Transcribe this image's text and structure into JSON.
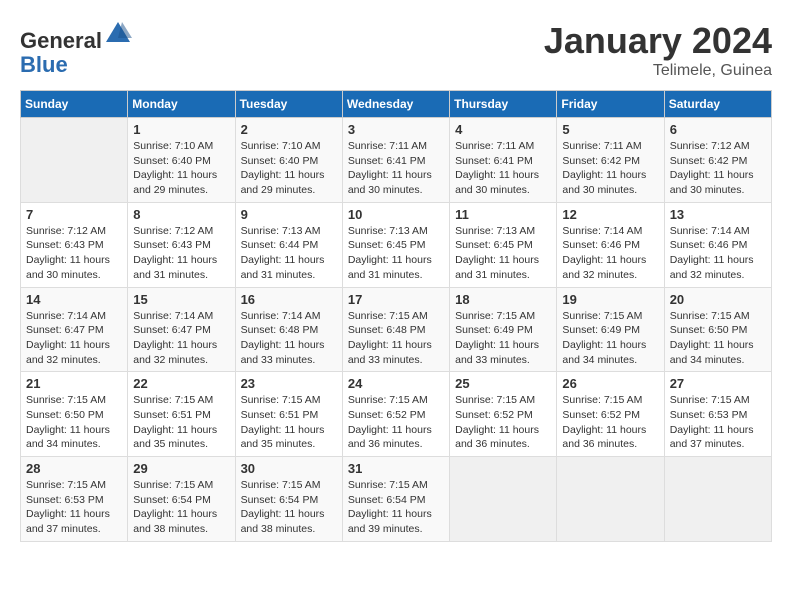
{
  "logo": {
    "general": "General",
    "blue": "Blue"
  },
  "header": {
    "title": "January 2024",
    "subtitle": "Telimele, Guinea"
  },
  "weekdays": [
    "Sunday",
    "Monday",
    "Tuesday",
    "Wednesday",
    "Thursday",
    "Friday",
    "Saturday"
  ],
  "weeks": [
    [
      {
        "day": "",
        "empty": true
      },
      {
        "day": "1",
        "sunrise": "7:10 AM",
        "sunset": "6:40 PM",
        "daylight": "11 hours and 29 minutes."
      },
      {
        "day": "2",
        "sunrise": "7:10 AM",
        "sunset": "6:40 PM",
        "daylight": "11 hours and 29 minutes."
      },
      {
        "day": "3",
        "sunrise": "7:11 AM",
        "sunset": "6:41 PM",
        "daylight": "11 hours and 30 minutes."
      },
      {
        "day": "4",
        "sunrise": "7:11 AM",
        "sunset": "6:41 PM",
        "daylight": "11 hours and 30 minutes."
      },
      {
        "day": "5",
        "sunrise": "7:11 AM",
        "sunset": "6:42 PM",
        "daylight": "11 hours and 30 minutes."
      },
      {
        "day": "6",
        "sunrise": "7:12 AM",
        "sunset": "6:42 PM",
        "daylight": "11 hours and 30 minutes."
      }
    ],
    [
      {
        "day": "7",
        "sunrise": "7:12 AM",
        "sunset": "6:43 PM",
        "daylight": "11 hours and 30 minutes."
      },
      {
        "day": "8",
        "sunrise": "7:12 AM",
        "sunset": "6:43 PM",
        "daylight": "11 hours and 31 minutes."
      },
      {
        "day": "9",
        "sunrise": "7:13 AM",
        "sunset": "6:44 PM",
        "daylight": "11 hours and 31 minutes."
      },
      {
        "day": "10",
        "sunrise": "7:13 AM",
        "sunset": "6:45 PM",
        "daylight": "11 hours and 31 minutes."
      },
      {
        "day": "11",
        "sunrise": "7:13 AM",
        "sunset": "6:45 PM",
        "daylight": "11 hours and 31 minutes."
      },
      {
        "day": "12",
        "sunrise": "7:14 AM",
        "sunset": "6:46 PM",
        "daylight": "11 hours and 32 minutes."
      },
      {
        "day": "13",
        "sunrise": "7:14 AM",
        "sunset": "6:46 PM",
        "daylight": "11 hours and 32 minutes."
      }
    ],
    [
      {
        "day": "14",
        "sunrise": "7:14 AM",
        "sunset": "6:47 PM",
        "daylight": "11 hours and 32 minutes."
      },
      {
        "day": "15",
        "sunrise": "7:14 AM",
        "sunset": "6:47 PM",
        "daylight": "11 hours and 32 minutes."
      },
      {
        "day": "16",
        "sunrise": "7:14 AM",
        "sunset": "6:48 PM",
        "daylight": "11 hours and 33 minutes."
      },
      {
        "day": "17",
        "sunrise": "7:15 AM",
        "sunset": "6:48 PM",
        "daylight": "11 hours and 33 minutes."
      },
      {
        "day": "18",
        "sunrise": "7:15 AM",
        "sunset": "6:49 PM",
        "daylight": "11 hours and 33 minutes."
      },
      {
        "day": "19",
        "sunrise": "7:15 AM",
        "sunset": "6:49 PM",
        "daylight": "11 hours and 34 minutes."
      },
      {
        "day": "20",
        "sunrise": "7:15 AM",
        "sunset": "6:50 PM",
        "daylight": "11 hours and 34 minutes."
      }
    ],
    [
      {
        "day": "21",
        "sunrise": "7:15 AM",
        "sunset": "6:50 PM",
        "daylight": "11 hours and 34 minutes."
      },
      {
        "day": "22",
        "sunrise": "7:15 AM",
        "sunset": "6:51 PM",
        "daylight": "11 hours and 35 minutes."
      },
      {
        "day": "23",
        "sunrise": "7:15 AM",
        "sunset": "6:51 PM",
        "daylight": "11 hours and 35 minutes."
      },
      {
        "day": "24",
        "sunrise": "7:15 AM",
        "sunset": "6:52 PM",
        "daylight": "11 hours and 36 minutes."
      },
      {
        "day": "25",
        "sunrise": "7:15 AM",
        "sunset": "6:52 PM",
        "daylight": "11 hours and 36 minutes."
      },
      {
        "day": "26",
        "sunrise": "7:15 AM",
        "sunset": "6:52 PM",
        "daylight": "11 hours and 36 minutes."
      },
      {
        "day": "27",
        "sunrise": "7:15 AM",
        "sunset": "6:53 PM",
        "daylight": "11 hours and 37 minutes."
      }
    ],
    [
      {
        "day": "28",
        "sunrise": "7:15 AM",
        "sunset": "6:53 PM",
        "daylight": "11 hours and 37 minutes."
      },
      {
        "day": "29",
        "sunrise": "7:15 AM",
        "sunset": "6:54 PM",
        "daylight": "11 hours and 38 minutes."
      },
      {
        "day": "30",
        "sunrise": "7:15 AM",
        "sunset": "6:54 PM",
        "daylight": "11 hours and 38 minutes."
      },
      {
        "day": "31",
        "sunrise": "7:15 AM",
        "sunset": "6:54 PM",
        "daylight": "11 hours and 39 minutes."
      },
      {
        "day": "",
        "empty": true
      },
      {
        "day": "",
        "empty": true
      },
      {
        "day": "",
        "empty": true
      }
    ]
  ]
}
